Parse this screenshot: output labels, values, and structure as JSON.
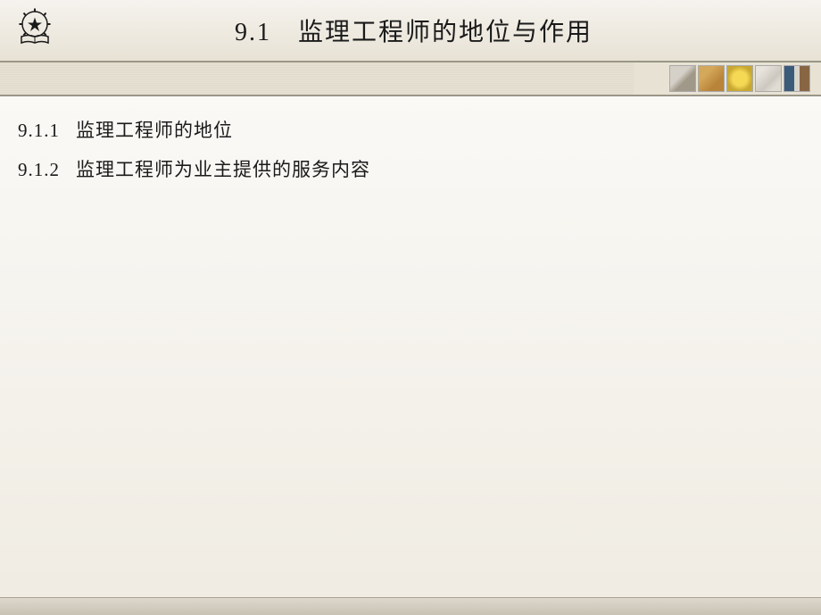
{
  "header": {
    "title": "9.1　监理工程师的地位与作用"
  },
  "icons": {
    "logo": "gear-star-book-icon",
    "bar": [
      "compass-icon",
      "hand-icon",
      "clock-icon",
      "drafting-icon",
      "people-icon"
    ]
  },
  "content": {
    "items": [
      {
        "num": "9.1.1",
        "text": "监理工程师的地位"
      },
      {
        "num": "9.1.2",
        "text": "监理工程师为业主提供的服务内容"
      }
    ]
  }
}
